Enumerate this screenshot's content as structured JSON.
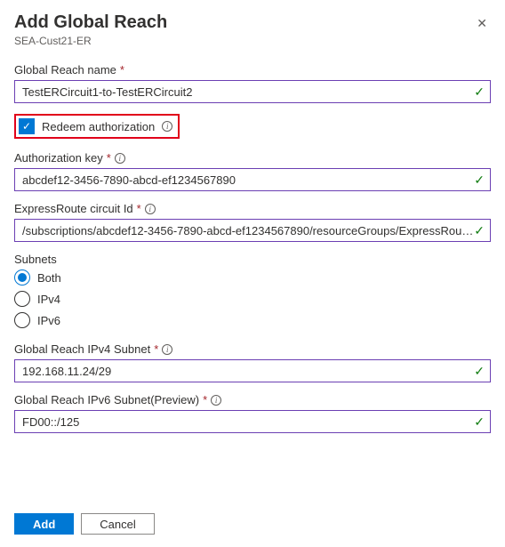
{
  "header": {
    "title": "Add Global Reach",
    "subtitle": "SEA-Cust21-ER"
  },
  "fields": {
    "name": {
      "label": "Global Reach name",
      "value": "TestERCircuit1-to-TestERCircuit2",
      "required": true
    },
    "redeem": {
      "label": "Redeem authorization",
      "checked": true
    },
    "authkey": {
      "label": "Authorization key",
      "value": "abcdef12-3456-7890-abcd-ef1234567890",
      "required": true
    },
    "circuit": {
      "label": "ExpressRoute circuit Id",
      "value": "/subscriptions/abcdef12-3456-7890-abcd-ef1234567890/resourceGroups/ExpressRoute...",
      "required": true
    },
    "subnets": {
      "label": "Subnets",
      "options": [
        "Both",
        "IPv4",
        "IPv6"
      ],
      "selected": "Both"
    },
    "ipv4": {
      "label": "Global Reach IPv4 Subnet",
      "value": "192.168.11.24/29",
      "required": true
    },
    "ipv6": {
      "label": "Global Reach IPv6 Subnet(Preview)",
      "value": "FD00::/125",
      "required": true
    }
  },
  "buttons": {
    "add": "Add",
    "cancel": "Cancel"
  }
}
